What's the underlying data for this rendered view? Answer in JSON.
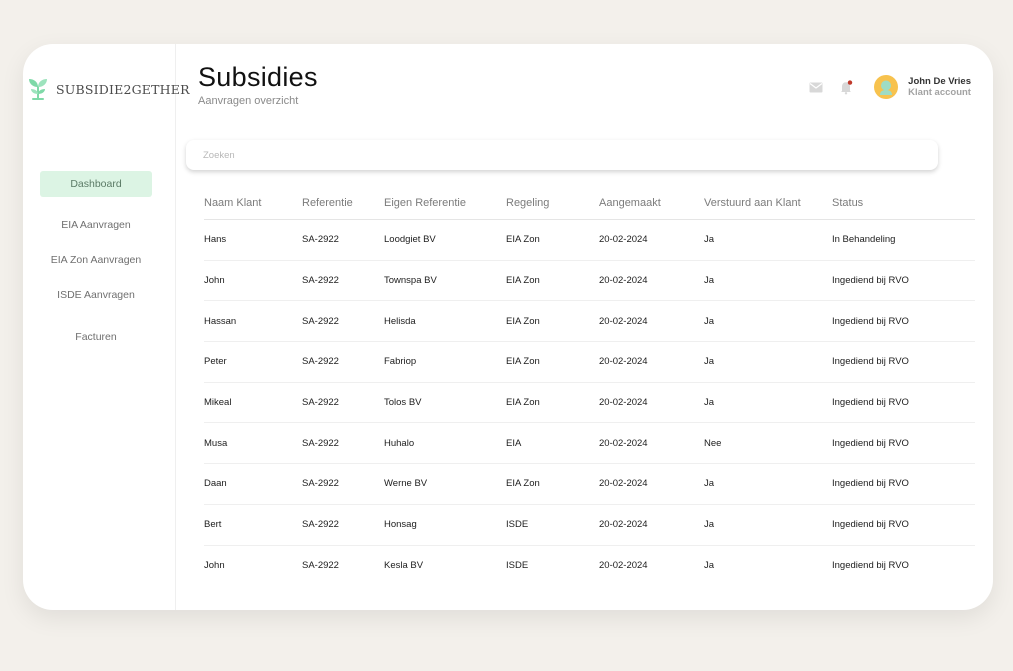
{
  "brand": {
    "logo_text": "SUBSIDIE2GETHER"
  },
  "sidebar": {
    "items": [
      {
        "label": "Dashboard",
        "active": true
      },
      {
        "label": "EIA Aanvragen",
        "active": false
      },
      {
        "label": "EIA Zon Aanvragen",
        "active": false
      },
      {
        "label": "ISDE Aanvragen",
        "active": false
      },
      {
        "label": "Facturen",
        "active": false
      }
    ]
  },
  "header": {
    "title": "Subsidies",
    "subtitle": "Aanvragen overzicht",
    "mail_icon": "mail-icon",
    "bell_icon": "bell-icon",
    "user": {
      "name": "John De Vries",
      "role": "Klant account"
    }
  },
  "search": {
    "placeholder": "Zoeken",
    "value": ""
  },
  "table": {
    "columns": [
      "Naam Klant",
      "Referentie",
      "Eigen Referentie",
      "Regeling",
      "Aangemaakt",
      "Verstuurd aan Klant",
      "Status"
    ],
    "rows": [
      [
        "Hans",
        "SA-2922",
        "Loodgiet BV",
        "EIA Zon",
        "20-02-2024",
        "Ja",
        "In Behandeling"
      ],
      [
        "John",
        "SA-2922",
        "Townspa BV",
        "EIA Zon",
        "20-02-2024",
        "Ja",
        "Ingediend bij RVO"
      ],
      [
        "Hassan",
        "SA-2922",
        "Helisda",
        "EIA Zon",
        "20-02-2024",
        "Ja",
        "Ingediend bij RVO"
      ],
      [
        "Peter",
        "SA-2922",
        "Fabriop",
        "EIA Zon",
        "20-02-2024",
        "Ja",
        "Ingediend bij RVO"
      ],
      [
        "Mikeal",
        "SA-2922",
        "Tolos BV",
        "EIA Zon",
        "20-02-2024",
        "Ja",
        "Ingediend bij RVO"
      ],
      [
        "Musa",
        "SA-2922",
        "Huhalo",
        "EIA",
        "20-02-2024",
        "Nee",
        "Ingediend bij RVO"
      ],
      [
        "Daan",
        "SA-2922",
        "Werne BV",
        "EIA Zon",
        "20-02-2024",
        "Ja",
        "Ingediend bij RVO"
      ],
      [
        "Bert",
        "SA-2922",
        "Honsag",
        "ISDE",
        "20-02-2024",
        "Ja",
        "Ingediend bij RVO"
      ],
      [
        "John",
        "SA-2922",
        "Kesla BV",
        "ISDE",
        "20-02-2024",
        "Ja",
        "Ingediend bij RVO"
      ]
    ]
  },
  "colors": {
    "accent_active_bg": "#dcf4e4",
    "logo_green": "#7fd9a8",
    "notification_dot": "#c0392b",
    "avatar": "#f7c24e",
    "page_bg": "#f3f0eb"
  }
}
